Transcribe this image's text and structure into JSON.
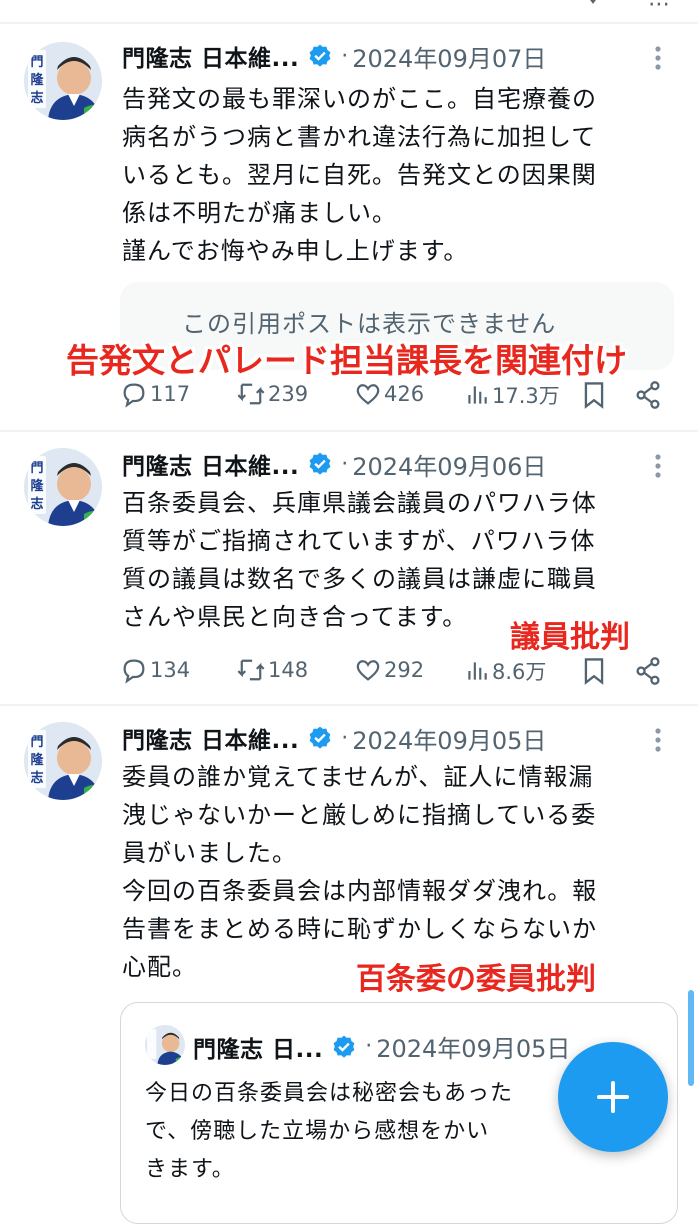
{
  "author_name": "門隆志 日本維...",
  "quoted_author_name": "門隆志 日...",
  "avatar_text": "門隆志",
  "separator": "·",
  "tweets": [
    {
      "date": "2024年09月07日",
      "body": "告発文の最も罪深いのがここ。自宅療養の\n病名がうつ病と書かれ違法行為に加担して\nいるとも。翌月に自死。告発文との因果関\n係は不明たが痛ましい。\n謹んでお悔やみ申し上げます。",
      "quote_unavailable": "この引用ポストは表示できません",
      "annotation": "告発文とパレード担当課長を関連付け",
      "replies": "117",
      "reposts": "239",
      "likes": "426",
      "views": "17.3万"
    },
    {
      "date": "2024年09月06日",
      "body": "百条委員会、兵庫県議会議員のパワハラ体\n質等がご指摘されていますが、パワハラ体\n質の議員は数名で多くの議員は謙虚に職員\nさんや県民と向き合ってます。",
      "annotation": "議員批判",
      "replies": "134",
      "reposts": "148",
      "likes": "292",
      "views": "8.6万"
    },
    {
      "date": "2024年09月05日",
      "body": "委員の誰か覚えてませんが、証人に情報漏\n洩じゃないかーと厳しめに指摘している委\n員がいました。\n今回の百条委員会は内部情報ダダ洩れ。報\n告書をまとめる時に恥ずかしくならないか\n心配。",
      "annotation": "百条委の委員批判",
      "quoted": {
        "date": "2024年09月05日",
        "body": "今日の百条委員会は秘密会もあった\nで、傍聴した立場から感想をかい\nきます。"
      }
    }
  ],
  "colors": {
    "accent": "#1d9bf0",
    "annotation_red": "#e8281f",
    "secondary_text": "#536471"
  },
  "icons": [
    "more-icon",
    "verified-icon",
    "reply-icon",
    "repost-icon",
    "like-icon",
    "views-icon",
    "bookmark-icon",
    "share-icon",
    "compose-plus-icon"
  ]
}
